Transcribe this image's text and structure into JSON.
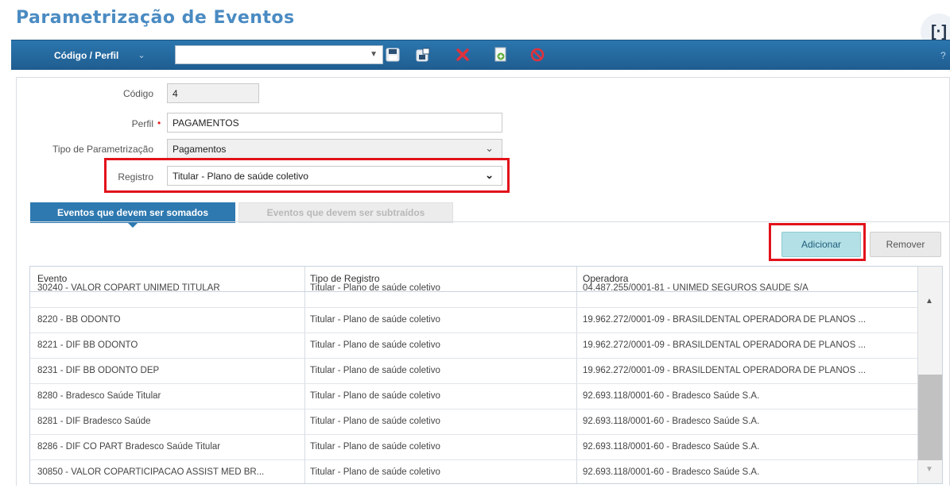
{
  "page": {
    "title": "Parametrização de Eventos"
  },
  "toolbar": {
    "selector_label": "Código / Perfil",
    "selector_chevron": "⌄",
    "combo_value": "",
    "icons": [
      "save-icon",
      "save-as-icon",
      "delete-icon",
      "new-icon",
      "cancel-icon"
    ],
    "help": "?"
  },
  "form": {
    "codigo": {
      "label": "Código",
      "value": "4"
    },
    "perfil": {
      "label": "Perfil",
      "required": "•",
      "value": "PAGAMENTOS"
    },
    "tipo": {
      "label": "Tipo de Parametrização",
      "value": "Pagamentos"
    },
    "registro": {
      "label": "Registro",
      "value": "Titular - Plano de saúde coletivo"
    }
  },
  "tabs": [
    {
      "label": "Eventos que devem ser somados",
      "active": true
    },
    {
      "label": "Eventos que devem ser subtraídos",
      "active": false
    }
  ],
  "actions": {
    "add": "Adicionar",
    "remove": "Remover"
  },
  "grid": {
    "columns": [
      "Evento",
      "Tipo de Registro",
      "Operadora"
    ],
    "rows": [
      {
        "evento": "30240 - VALOR COPART UNIMED TITULAR",
        "tipo": "Titular - Plano de saúde coletivo",
        "operadora": "04.487.255/0001-81 - UNIMED SEGUROS SAUDE S/A"
      },
      {
        "evento": "8220 - BB ODONTO",
        "tipo": "Titular - Plano de saúde coletivo",
        "operadora": "19.962.272/0001-09 - BRASILDENTAL OPERADORA DE PLANOS ..."
      },
      {
        "evento": "8221 - DIF BB ODONTO",
        "tipo": "Titular - Plano de saúde coletivo",
        "operadora": "19.962.272/0001-09 - BRASILDENTAL OPERADORA DE PLANOS ..."
      },
      {
        "evento": "8231 - DIF BB ODONTO DEP",
        "tipo": "Titular - Plano de saúde coletivo",
        "operadora": "19.962.272/0001-09 - BRASILDENTAL OPERADORA DE PLANOS ..."
      },
      {
        "evento": "8280 - Bradesco Saúde Titular",
        "tipo": "Titular - Plano de saúde coletivo",
        "operadora": "92.693.118/0001-60 - Bradesco Saúde S.A."
      },
      {
        "evento": "8281 - DIF Bradesco Saúde",
        "tipo": "Titular - Plano de saúde coletivo",
        "operadora": "92.693.118/0001-60 - Bradesco Saúde S.A."
      },
      {
        "evento": "8286 - DIF CO PART Bradesco Saúde Titular",
        "tipo": "Titular - Plano de saúde coletivo",
        "operadora": "92.693.118/0001-60 - Bradesco Saúde S.A."
      },
      {
        "evento": "30850 - VALOR COPARTICIPACAO ASSIST MED BR...",
        "tipo": "Titular - Plano de saúde coletivo",
        "operadora": "92.693.118/0001-60 - Bradesco Saúde S.A."
      }
    ]
  },
  "colors": {
    "brand": "#4a8bc2",
    "toolbar": "#2b76ae",
    "highlight": "#e2121b",
    "add_button": "#b3e0e6"
  }
}
